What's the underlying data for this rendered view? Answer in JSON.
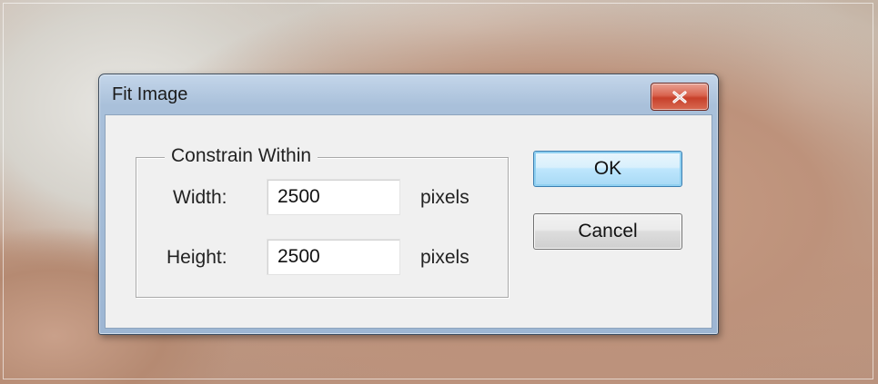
{
  "dialog": {
    "title": "Fit Image",
    "close_icon": "close-x-icon",
    "group": {
      "legend": "Constrain Within",
      "width": {
        "label": "Width:",
        "value": "2500",
        "unit": "pixels"
      },
      "height": {
        "label": "Height:",
        "value": "2500",
        "unit": "pixels"
      }
    },
    "ok_label": "OK",
    "cancel_label": "Cancel"
  },
  "colors": {
    "titlebar": "#a9c0da",
    "client": "#f0f0f0",
    "close_button": "#c7402a",
    "ok_focus": "#3c7fb1"
  }
}
